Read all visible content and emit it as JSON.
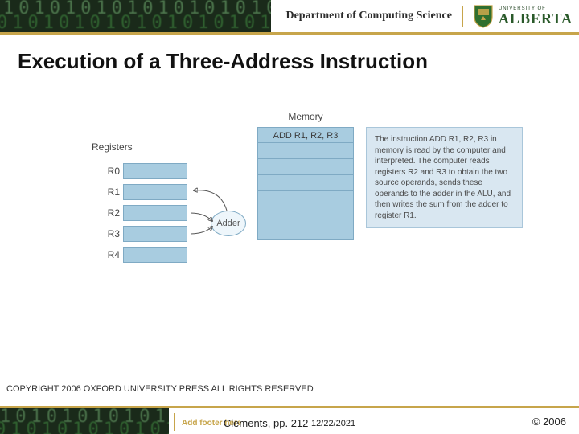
{
  "header": {
    "department": "Department of Computing Science",
    "university_small": "UNIVERSITY OF",
    "university_big": "ALBERTA"
  },
  "title": "Execution of a Three-Address Instruction",
  "diagram": {
    "registers_label": "Registers",
    "registers": [
      "R0",
      "R1",
      "R2",
      "R3",
      "R4"
    ],
    "memory_label": "Memory",
    "memory_instruction": "ADD  R1, R2, R3",
    "memory_rows_blank": 6,
    "adder_label": "Adder",
    "explanation": "The instruction ADD R1, R2, R3 in memory is read by the computer and interpreted. The computer reads registers R2 and R3 to obtain the two source operands, sends these operands to the adder in the ALU, and then writes the sum from the adder to register R1."
  },
  "oxford_line": "COPYRIGHT 2006  OXFORD UNIVERSITY PRESS ALL RIGHTS RESERVED",
  "footer": {
    "add_footer": "Add footer here",
    "clements": "Clements, pp. 212",
    "date": "12/22/2021",
    "copyright": "© 2006"
  }
}
